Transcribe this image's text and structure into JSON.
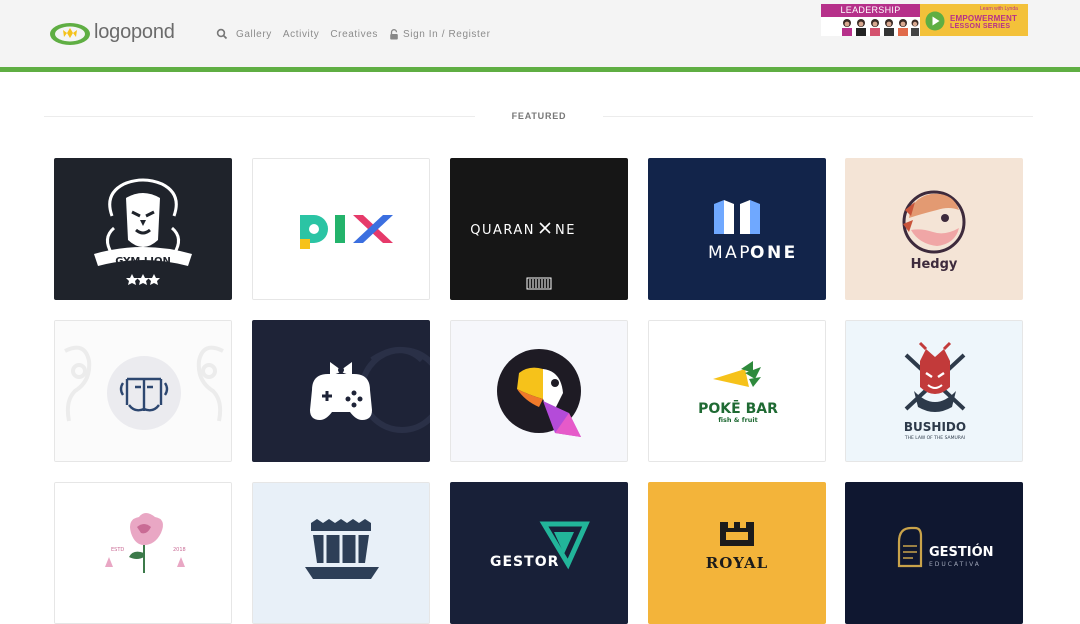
{
  "header": {
    "logo_text": "logopond",
    "nav": {
      "gallery": "Gallery",
      "activity": "Activity",
      "creatives": "Creatives",
      "signin": "Sign In / Register"
    },
    "ad": {
      "title": "LEADERSHIP",
      "brand": "Learn with Lynda",
      "line1": "EMPOWERMENT",
      "line2": "LESSON SERIES"
    }
  },
  "featured": {
    "label": "FEATURED"
  },
  "tiles": {
    "gymlion": {
      "name": "GYM LION"
    },
    "pix": {
      "name": "PIX"
    },
    "quarantine": {
      "left": "QUARAN",
      "right": "NE"
    },
    "mapone": {
      "name_left": "MAP",
      "name_right": "ONE"
    },
    "hedgy": {
      "name": "Hedgy"
    },
    "poke": {
      "name": "POKĒ BAR",
      "tagline": "fish & fruit"
    },
    "bushido": {
      "name": "BUSHIDO",
      "tagline": "THE LAW OF THE SAMURAI"
    },
    "rose": {
      "estd": "ESTD",
      "year": "2018"
    },
    "gestor": {
      "name": "GESTOR"
    },
    "royal": {
      "name": "ROYAL"
    },
    "gestion": {
      "name": "GESTIÓN",
      "tagline": "EDUCATIVA"
    }
  },
  "colors": {
    "brand_green": "#5fae43",
    "header_bg": "#f4f4f4",
    "ad_pink": "#b6308a",
    "ad_yellow": "#f3c13a",
    "dark_navy": "#1c2035",
    "mapone_blue": "#12244a",
    "royal_yellow": "#f3b43a",
    "hedgy_bg": "#f4e4d6"
  }
}
